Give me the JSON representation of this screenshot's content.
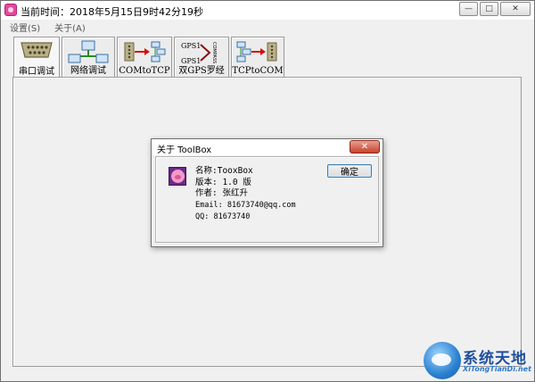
{
  "window": {
    "title": "当前时间：2018年5月15日9时42分19秒",
    "controls": {
      "minimize": "—",
      "maximize": "□",
      "close": "✕"
    }
  },
  "menu": {
    "items": [
      {
        "label": "设置(S)"
      },
      {
        "label": "关于(A)"
      }
    ]
  },
  "tabs": [
    {
      "label": "串口调试",
      "icon": "serial-port-icon",
      "active": true
    },
    {
      "label": "网络调试",
      "icon": "network-icon",
      "active": false
    },
    {
      "label": "COMtoTCP",
      "icon": "com-to-tcp-icon",
      "active": false
    },
    {
      "label": "双GPS罗经",
      "icon": "gps-compass-icon",
      "active": false,
      "graphic_text": [
        "GPS1",
        "GPS1",
        "COMPASS"
      ]
    },
    {
      "label": "TCPtoCOM",
      "icon": "tcp-to-com-icon",
      "active": false
    }
  ],
  "dialog": {
    "title": "关于 ToolBox",
    "close_label": "✕",
    "ok_label": "确定",
    "info": {
      "name": "名称:TooxBox",
      "version": "版本: 1.0 版",
      "author": "作者: 张红升",
      "email": "Email: 81673740@qq.com",
      "qq": "QQ: 81673740"
    }
  },
  "watermark": {
    "title": "系统天地",
    "subtitle": "XiTongTianDi.net"
  },
  "colors": {
    "window_bg": "#f0f0f0",
    "dialog_close": "#c7402c",
    "ok_border": "#3c7fb1",
    "watermark_blue": "#1f4f9c"
  }
}
